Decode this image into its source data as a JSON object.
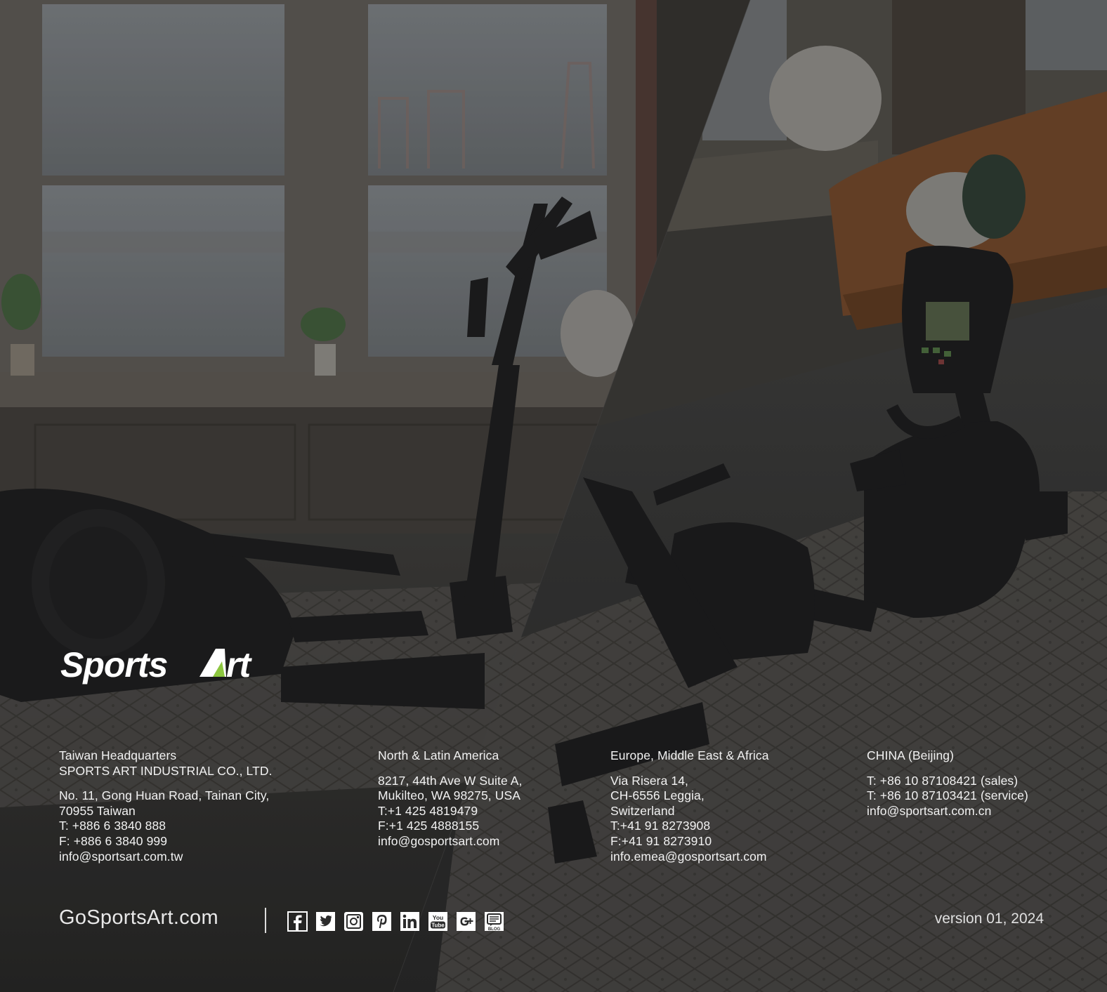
{
  "brand": {
    "logo_text": "SportsArt",
    "accent": "#8cc63f"
  },
  "offices": [
    {
      "heading": [
        "Taiwan Headquarters",
        "SPORTS ART INDUSTRIAL CO., LTD."
      ],
      "lines": [
        "No. 11, Gong Huan Road, Tainan City,",
        "70955 Taiwan",
        "T: +886 6 3840 888",
        "F: +886 6 3840 999",
        "info@sportsart.com.tw"
      ]
    },
    {
      "heading": [
        "North & Latin America"
      ],
      "lines": [
        "8217, 44th Ave W Suite A,",
        "Mukilteo, WA 98275, USA",
        "T:+1 425 4819479",
        "F:+1 425 4888155",
        "info@gosportsart.com"
      ]
    },
    {
      "heading": [
        "Europe, Middle East & Africa"
      ],
      "lines": [
        "Via Risera 14,",
        "CH-6556 Leggia,",
        "Switzerland",
        "T:+41 91 8273908",
        "F:+41 91 8273910",
        "info.emea@gosportsart.com"
      ]
    },
    {
      "heading": [
        "CHINA (Beijing)"
      ],
      "lines": [
        "T: +86 10 87108421 (sales)",
        "T: +86 10 87103421 (service)",
        "info@sportsart.com.cn"
      ]
    }
  ],
  "footer": {
    "website": "GoSportsArt.com",
    "version": "version 01, 2024",
    "social_icons": [
      "facebook-icon",
      "twitter-icon",
      "instagram-icon",
      "pinterest-icon",
      "linkedin-icon",
      "youtube-icon",
      "google-plus-icon",
      "blog-icon"
    ],
    "youtube_text": [
      "You",
      "Tube"
    ],
    "blog_text": "BLOG"
  }
}
